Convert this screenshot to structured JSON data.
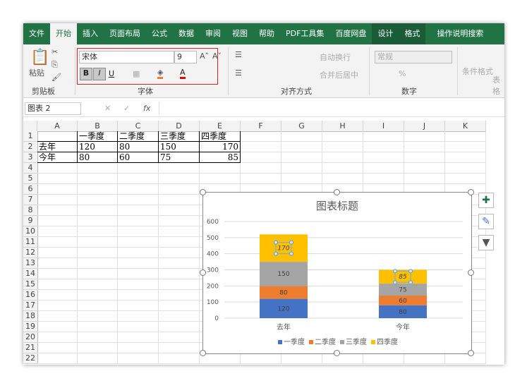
{
  "tabs": [
    "文件",
    "开始",
    "插入",
    "页面布局",
    "公式",
    "数据",
    "审阅",
    "视图",
    "帮助",
    "PDF工具集",
    "百度网盘",
    "设计",
    "格式"
  ],
  "tell_me": "操作说明搜索",
  "ribbon": {
    "paste": "粘贴",
    "clipboard": "剪贴板",
    "font_name": "宋体",
    "font_size": "9",
    "bold": "B",
    "italic": "I",
    "underline": "U",
    "font_group": "字体",
    "wrap": "自动换行",
    "merge": "合并后居中",
    "align_group": "对齐方式",
    "number_format": "常规",
    "number_group": "数字",
    "cond_format": "条件格式",
    "table_fmt": "表格"
  },
  "formula": {
    "name_box": "图表 2",
    "fx": "fx"
  },
  "columns": [
    "A",
    "B",
    "C",
    "D",
    "E",
    "F",
    "G",
    "H",
    "I",
    "J",
    "K"
  ],
  "rows": [
    "1",
    "2",
    "3",
    "4",
    "5",
    "6",
    "7",
    "8",
    "9",
    "10",
    "11",
    "12",
    "13",
    "14",
    "15",
    "16",
    "17",
    "18",
    "19",
    "20",
    "21",
    "22"
  ],
  "table": {
    "header": [
      "",
      "一季度",
      "二季度",
      "三季度",
      "四季度"
    ],
    "rows": [
      [
        "去年",
        "120",
        "80",
        "150",
        "170"
      ],
      [
        "今年",
        "80",
        "60",
        "75",
        "85"
      ]
    ]
  },
  "chart_data": {
    "type": "bar",
    "stacked": true,
    "title": "图表标题",
    "categories": [
      "去年",
      "今年"
    ],
    "series": [
      {
        "name": "一季度",
        "values": [
          120,
          80
        ],
        "color": "#4472c4"
      },
      {
        "name": "二季度",
        "values": [
          80,
          60
        ],
        "color": "#ed7d31"
      },
      {
        "name": "三季度",
        "values": [
          150,
          75
        ],
        "color": "#a5a5a5"
      },
      {
        "name": "四季度",
        "values": [
          170,
          85
        ],
        "color": "#ffc000"
      }
    ],
    "ylim": [
      0,
      600
    ],
    "yticks": [
      "0",
      "100",
      "200",
      "300",
      "400",
      "500",
      "600"
    ],
    "legend": "bottom",
    "grid": true
  }
}
